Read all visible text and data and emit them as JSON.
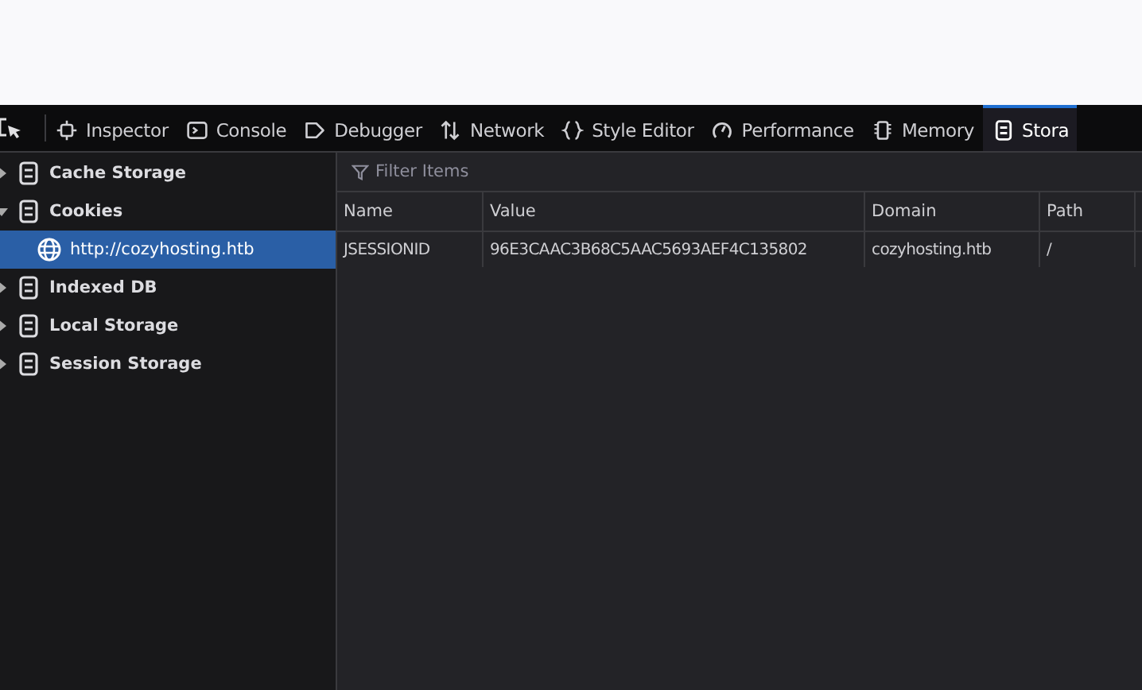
{
  "toolbar": {
    "tabs": [
      {
        "label": "Inspector",
        "selected": false
      },
      {
        "label": "Console",
        "selected": false
      },
      {
        "label": "Debugger",
        "selected": false
      },
      {
        "label": "Network",
        "selected": false
      },
      {
        "label": "Style Editor",
        "selected": false
      },
      {
        "label": "Performance",
        "selected": false
      },
      {
        "label": "Memory",
        "selected": false
      },
      {
        "label": "Stora",
        "selected": true
      }
    ]
  },
  "sidebar": {
    "items": [
      {
        "label": "Cache Storage",
        "expanded": false,
        "selected": false
      },
      {
        "label": "Cookies",
        "expanded": true,
        "selected": false,
        "children": [
          {
            "label": "http://cozyhosting.htb",
            "selected": true
          }
        ]
      },
      {
        "label": "Indexed DB",
        "expanded": false,
        "selected": false
      },
      {
        "label": "Local Storage",
        "expanded": false,
        "selected": false
      },
      {
        "label": "Session Storage",
        "expanded": false,
        "selected": false
      }
    ]
  },
  "filter": {
    "placeholder": "Filter Items"
  },
  "table": {
    "columns": [
      "Name",
      "Value",
      "Domain",
      "Path"
    ],
    "rows": [
      [
        "JSESSIONID",
        "96E3CAAC3B68C5AAC5693AEF4C135802",
        "cozyhosting.htb",
        "/"
      ]
    ]
  }
}
